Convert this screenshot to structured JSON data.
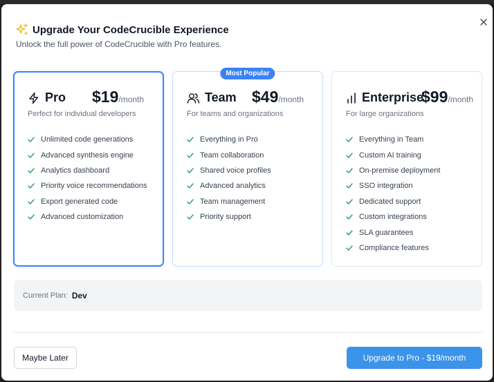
{
  "header": {
    "title": "Upgrade Your CodeCrucible Experience",
    "subtitle": "Unlock the full power of CodeCrucible with Pro features."
  },
  "plans": [
    {
      "name": "Pro",
      "icon": "lightning-icon",
      "price": "$19",
      "period": "/month",
      "description": "Perfect for individual developers",
      "selected": true,
      "features": [
        "Unlimited code generations",
        "Advanced synthesis engine",
        "Analytics dashboard",
        "Priority voice recommendations",
        "Export generated code",
        "Advanced customization"
      ]
    },
    {
      "name": "Team",
      "icon": "users-icon",
      "price": "$49",
      "period": "/month",
      "description": "For teams and organizations",
      "badge": "Most Popular",
      "features": [
        "Everything in Pro",
        "Team collaboration",
        "Shared voice profiles",
        "Advanced analytics",
        "Team management",
        "Priority support"
      ]
    },
    {
      "name": "Enterprise",
      "icon": "bar-chart-icon",
      "price": "$99",
      "period": "/month",
      "description": "For large organizations",
      "features": [
        "Everything in Team",
        "Custom AI training",
        "On-premise deployment",
        "SSO integration",
        "Dedicated support",
        "Custom integrations",
        "SLA guarantees",
        "Compliance features"
      ]
    }
  ],
  "current_plan": {
    "label": "Current Plan:",
    "value": "Dev"
  },
  "actions": {
    "later": "Maybe Later",
    "upgrade": "Upgrade to Pro - $19/month"
  },
  "colors": {
    "accent": "#3b82f6",
    "check": "#22a35a",
    "sparkle": "#f5b400"
  }
}
